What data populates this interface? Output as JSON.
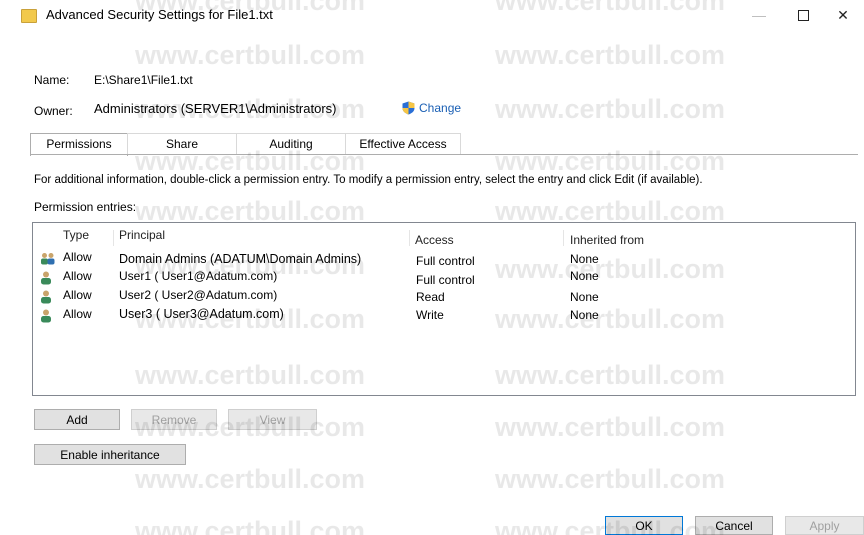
{
  "window": {
    "title": "Advanced Security Settings for File1.txt",
    "minimize": "—",
    "close": "✕"
  },
  "object": {
    "name_label": "Name:",
    "name_value": "E:\\Share1\\File1.txt",
    "owner_label": "Owner:",
    "owner_value": "Administrators (SERVER1\\Administrators)",
    "change_link": "Change"
  },
  "tabs": [
    {
      "label": "Permissions",
      "active": true
    },
    {
      "label": "Share",
      "active": false
    },
    {
      "label": "Auditing",
      "active": false
    },
    {
      "label": "Effective Access",
      "active": false
    }
  ],
  "info_text": "For additional information, double-click a permission entry. To modify a permission entry, select the entry and click Edit (if available).",
  "entries_label": "Permission entries:",
  "columns": {
    "type": "Type",
    "principal": "Principal",
    "access": "Access",
    "inherited": "Inherited from"
  },
  "entries": [
    {
      "icon": "group-icon",
      "type": "Allow",
      "principal": "Domain Admins (ADATUM\\Domain Admins)",
      "access": "Full control",
      "inherited": "None"
    },
    {
      "icon": "user-icon",
      "type": "Allow",
      "principal": "User1 ( User1@Adatum.com)",
      "access": "Full control",
      "inherited": "None"
    },
    {
      "icon": "user-icon",
      "type": "Allow",
      "principal": "User2 ( User2@Adatum.com)",
      "access": "Read",
      "inherited": "None"
    },
    {
      "icon": "user-icon",
      "type": "Allow",
      "principal": "User3 ( User3@Adatum.com)",
      "access": "Write",
      "inherited": "None"
    }
  ],
  "buttons": {
    "add": "Add",
    "remove": "Remove",
    "view": "View",
    "enable_inheritance": "Enable inheritance",
    "ok": "OK",
    "cancel": "Cancel",
    "apply": "Apply"
  },
  "watermark": "www.certbull.com",
  "colors": {
    "link": "#1a5fb4",
    "default_button_border": "#0078d7",
    "folder_icon": "#f2c94c"
  }
}
